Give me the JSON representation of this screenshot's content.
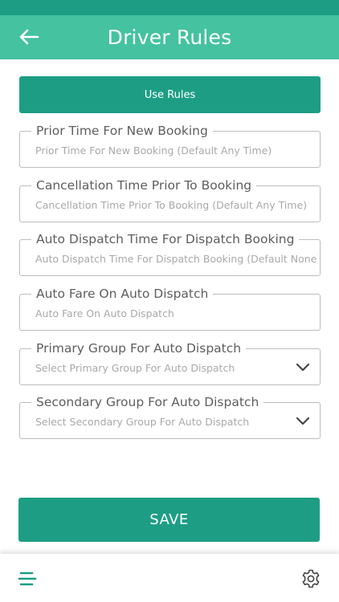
{
  "header": {
    "title": "Driver Rules",
    "back_icon": "arrow-left-icon",
    "bg_color": "#45c29f",
    "status_color": "#1d9e84"
  },
  "use_rules": {
    "label": "Use Rules"
  },
  "fields": [
    {
      "label": "Prior Time For New Booking",
      "placeholder": "Prior Time For New Booking (Default Any Time)",
      "type": "text"
    },
    {
      "label": "Cancellation Time Prior To Booking",
      "placeholder": "Cancellation Time Prior To Booking (Default Any Time)",
      "type": "text"
    },
    {
      "label": "Auto Dispatch Time For Dispatch Booking",
      "placeholder": "Auto Dispatch Time For Dispatch Booking (Default None)",
      "type": "text"
    },
    {
      "label": "Auto Fare On Auto Dispatch",
      "placeholder": "Auto Fare On Auto Dispatch",
      "type": "text"
    },
    {
      "label": "Primary Group For Auto Dispatch",
      "placeholder": "Select Primary Group For Auto Dispatch",
      "type": "select"
    },
    {
      "label": "Secondary Group For Auto Dispatch",
      "placeholder": "Select Secondary Group For Auto Dispatch",
      "type": "select"
    }
  ],
  "save": {
    "label": "SAVE"
  },
  "bottom_bar": {
    "menu_icon": "hamburger-menu-icon",
    "settings_icon": "gear-icon"
  },
  "colors": {
    "accent": "#1d9e84",
    "border": "#bdbdbd",
    "label_text": "#5e5e5e",
    "placeholder_text": "#a9a9a9"
  }
}
